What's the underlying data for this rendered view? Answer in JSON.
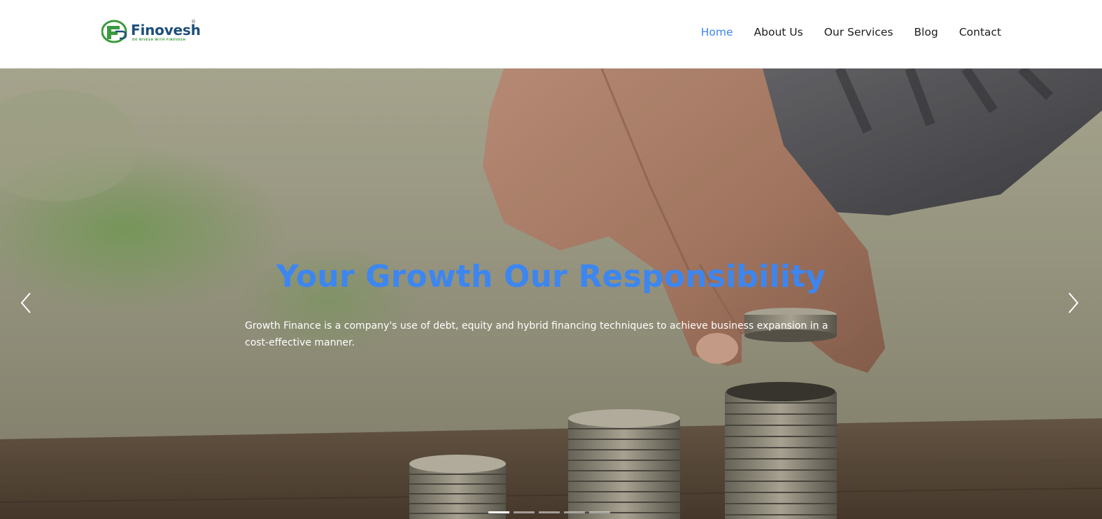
{
  "brand": {
    "name": "Finovesh",
    "registered_mark": "®",
    "tagline": "DO NIVESH WITH FINOVESH",
    "colors": {
      "green": "#3b9a3e",
      "navy": "#1e4f7a"
    }
  },
  "nav": {
    "items": [
      {
        "label": "Home",
        "active": true
      },
      {
        "label": "About Us",
        "active": false
      },
      {
        "label": "Our Services",
        "active": false
      },
      {
        "label": "Blog",
        "active": false
      },
      {
        "label": "Contact",
        "active": false
      }
    ],
    "active_color": "#3d86f0"
  },
  "hero": {
    "title": "Your Growth Our Responsibility",
    "description": "Growth Finance is a company's use of debt, equity and hybrid financing techniques to achieve business expansion in a cost-effective manner.",
    "title_color": "#3d86f0",
    "prev_icon": "chevron-left-icon",
    "next_icon": "chevron-right-icon",
    "slides_count": 5,
    "active_slide": 1
  }
}
